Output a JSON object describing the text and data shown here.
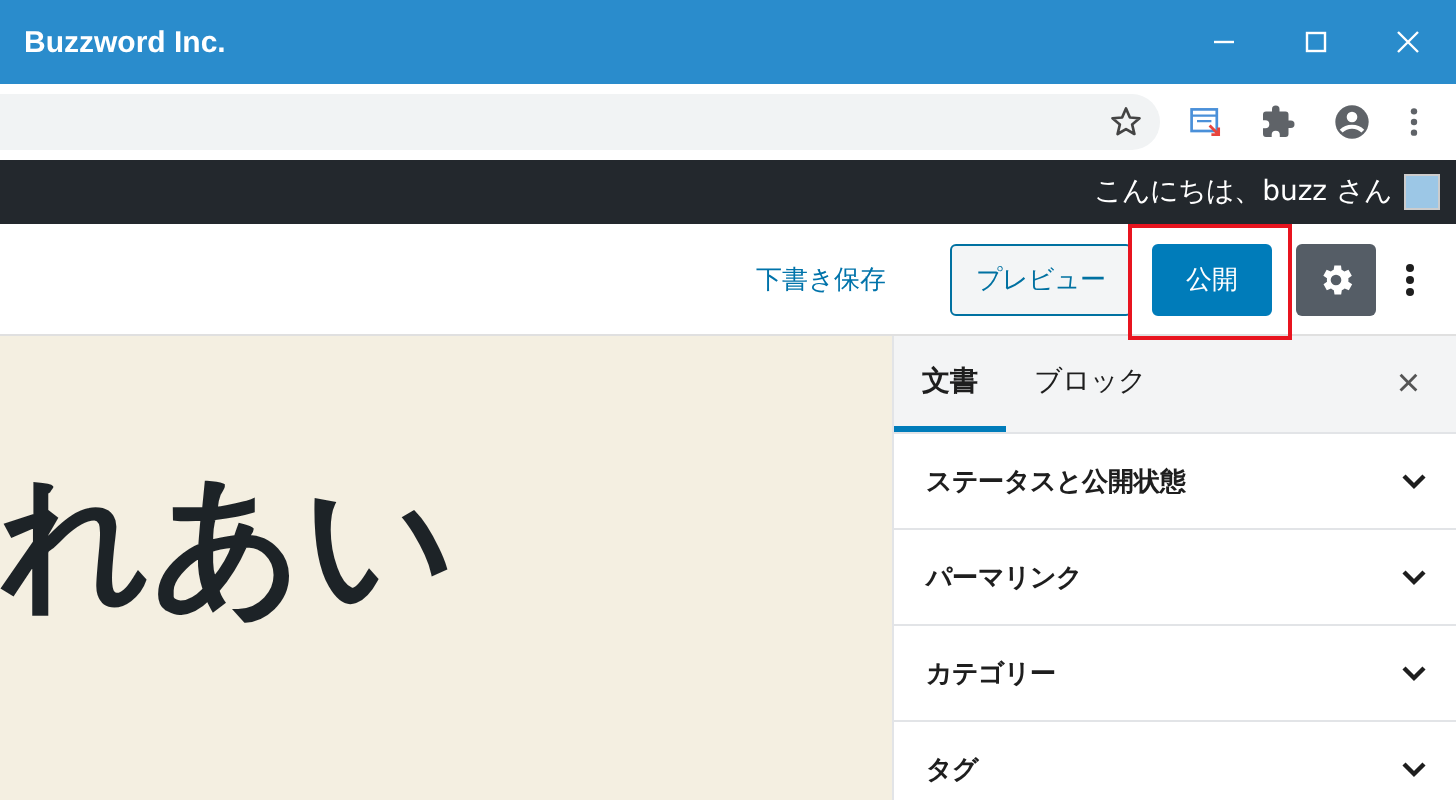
{
  "window": {
    "title": "Buzzword Inc."
  },
  "admin_bar": {
    "greeting": "こんにちは、buzz さん"
  },
  "editor_header": {
    "buttons": [
      {
        "kind": "link",
        "label": "下書き保存"
      },
      {
        "kind": "outline",
        "label": "プレビュー"
      },
      {
        "kind": "primary",
        "label": "公開",
        "highlighted": true
      }
    ],
    "settings_active": true
  },
  "content": {
    "title": "れあい"
  },
  "sidebar": {
    "tabs": [
      {
        "label": "文書",
        "selected": true
      },
      {
        "label": "ブロック",
        "selected": false
      }
    ],
    "close": "×",
    "panels": [
      {
        "label": "ステータスと公開状態",
        "expanded": false
      },
      {
        "label": "パーマリンク",
        "expanded": false
      },
      {
        "label": "カテゴリー",
        "expanded": false
      },
      {
        "label": "タグ",
        "expanded": false
      }
    ]
  }
}
